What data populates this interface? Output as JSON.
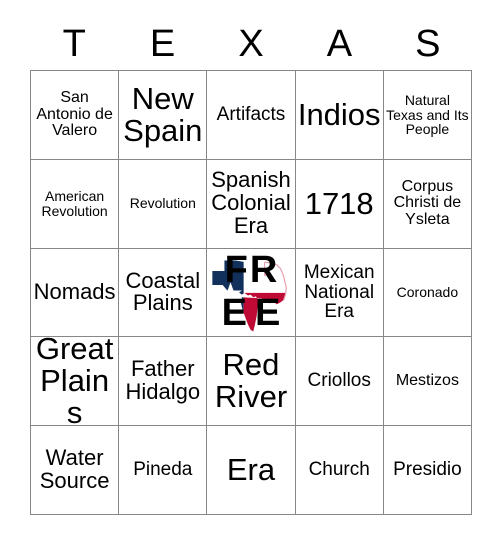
{
  "card": {
    "title": "TEXAS Bingo Card",
    "header_letters": [
      "T",
      "E",
      "X",
      "A",
      "S"
    ],
    "border_color": "#878787",
    "background_color": "#ffffff",
    "text_color": "#000000",
    "free_space": {
      "label": "FREE",
      "letters_top": [
        "F",
        "R"
      ],
      "letters_bottom": [
        "E",
        "E"
      ],
      "graphic": "texas-state-flag-shape",
      "flag_navy": "#11305C",
      "flag_red": "#BE0A34",
      "flag_white": "#FFFFFF",
      "outline_pink": "#E8A0AE",
      "star_color": "#FFFFFF"
    },
    "rows": [
      [
        {
          "text": "San Antonio de Valero",
          "size": "fs-s"
        },
        {
          "text": "New Spain",
          "size": "fs-xxl"
        },
        {
          "text": "Artifacts",
          "size": "fs-m"
        },
        {
          "text": "Indios",
          "size": "fs-xxl"
        },
        {
          "text": "Natural Texas and Its People",
          "size": "fs-xs"
        }
      ],
      [
        {
          "text": "American Revolution",
          "size": "fs-xs"
        },
        {
          "text": "Revolution",
          "size": "fs-xs"
        },
        {
          "text": "Spanish Colonial Era",
          "size": "fs-l"
        },
        {
          "text": "1718",
          "size": "fs-xxl"
        },
        {
          "text": "Corpus Christi de Ysleta",
          "size": "fs-s"
        }
      ],
      [
        {
          "text": "Nomads",
          "size": "fs-l"
        },
        {
          "text": "Coastal Plains",
          "size": "fs-l"
        },
        {
          "text": "FREE",
          "size": "free"
        },
        {
          "text": "Mexican National Era",
          "size": "fs-m"
        },
        {
          "text": "Coronado",
          "size": "fs-xs"
        }
      ],
      [
        {
          "text": "Great Plains",
          "size": "fs-xxl"
        },
        {
          "text": "Father Hidalgo",
          "size": "fs-l"
        },
        {
          "text": "Red River",
          "size": "fs-xxl"
        },
        {
          "text": "Criollos",
          "size": "fs-m"
        },
        {
          "text": "Mestizos",
          "size": "fs-s"
        }
      ],
      [
        {
          "text": "Water Source",
          "size": "fs-l"
        },
        {
          "text": "Pineda",
          "size": "fs-m"
        },
        {
          "text": "Era",
          "size": "fs-xxl"
        },
        {
          "text": "Church",
          "size": "fs-m"
        },
        {
          "text": "Presidio",
          "size": "fs-m"
        }
      ]
    ]
  }
}
